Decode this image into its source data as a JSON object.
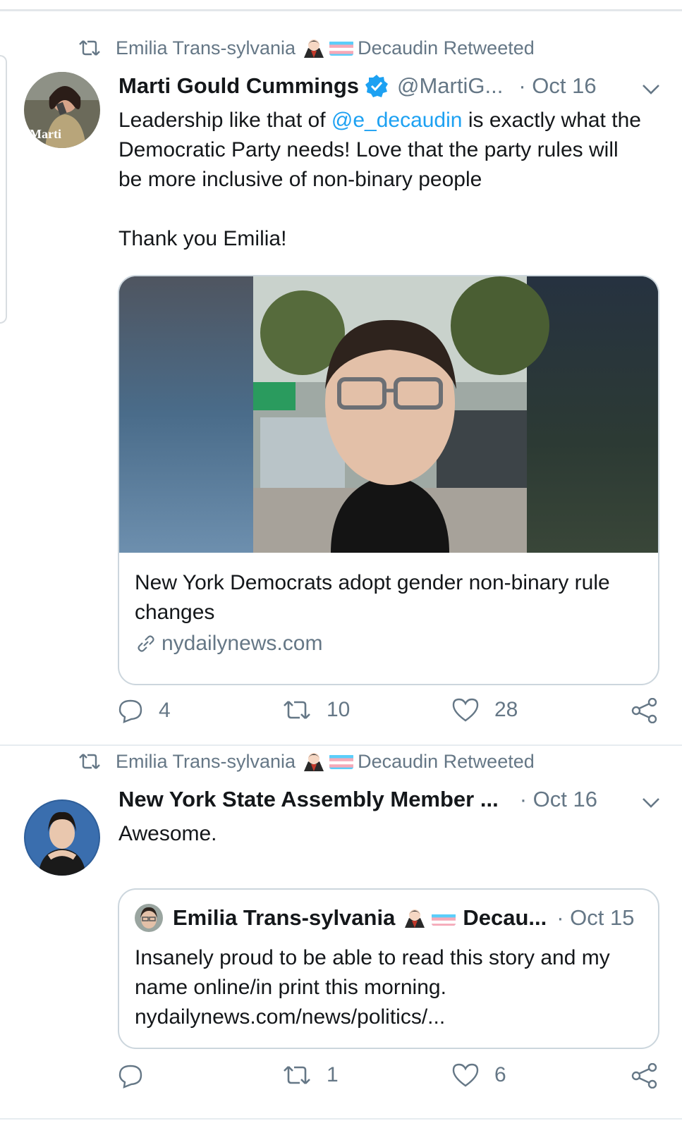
{
  "colors": {
    "accent": "#1da1f2",
    "muted": "#657786",
    "border": "#ccd6dd",
    "verified": "#1da1f2"
  },
  "tweets": [
    {
      "retweeted_by": "Emilia Trans-sylvania",
      "retweeted_suffix": "Decaudin Retweeted",
      "author_name": "Marti Gould Cummings",
      "author_handle": "@MartiG...",
      "date": "· Oct 16",
      "avatar_text": "Marti",
      "text_before_mention": "Leadership like that of ",
      "mention": "@e_decaudin",
      "text_after_mention": " is exactly what the Democratic Party needs! Love that the party rules will be more inclusive of non-binary people",
      "text_line_2": "Thank you Emilia!",
      "card": {
        "title": "New York Democrats adopt gender non-binary rule changes",
        "domain": "nydailynews.com"
      },
      "replies": "4",
      "retweets": "10",
      "likes": "28"
    },
    {
      "retweeted_by": "Emilia Trans-sylvania",
      "retweeted_suffix": "Decaudin Retweeted",
      "author_name": "New York State Assembly Member ...",
      "date": "· Oct 16",
      "text": "Awesome.",
      "quoted": {
        "author_name": "Emilia Trans-sylvania",
        "author_suffix": "Decau...",
        "date": "· Oct 15",
        "text": "Insanely proud to be able to read this story and my name online/in print this morning. nydailynews.com/news/politics/..."
      },
      "replies": "",
      "retweets": "1",
      "likes": "6"
    }
  ]
}
